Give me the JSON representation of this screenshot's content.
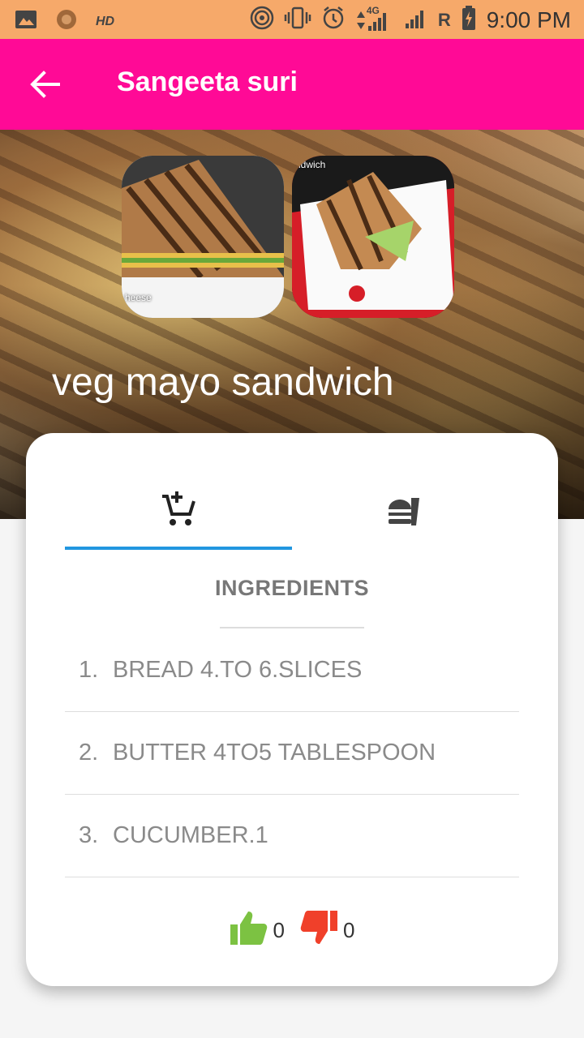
{
  "status_bar": {
    "hd_label": "HD",
    "network": "4G",
    "roaming": "R",
    "time": "9:00 PM",
    "icons": [
      "gallery-icon",
      "app-icon",
      "hotspot-icon",
      "vibrate-icon",
      "alarm-icon",
      "signal-icon",
      "battery-icon"
    ]
  },
  "app_bar": {
    "back_icon": "arrow-back-icon",
    "title": "Sangeeta suri",
    "color": "#ff0a96"
  },
  "hero": {
    "thumbnails": [
      {
        "caption": "heese"
      },
      {
        "caption": "ndwich"
      }
    ],
    "recipe_name": "veg mayo sandwich"
  },
  "tabs": [
    {
      "icon": "cart-add-icon",
      "active": true
    },
    {
      "icon": "food-icon",
      "active": false
    }
  ],
  "ingredients": {
    "title": "INGREDIENTS",
    "items": [
      {
        "num": "1.",
        "text": "BREAD 4.TO 6.SLICES"
      },
      {
        "num": "2.",
        "text": "BUTTER 4TO5 TABLESPOON"
      },
      {
        "num": "3.",
        "text": "CUCUMBER.1"
      }
    ]
  },
  "votes": {
    "likes": "0",
    "dislikes": "0",
    "like_color": "#7cc242",
    "dislike_color": "#f0402a"
  },
  "colors": {
    "status_bar": "#f6a96a",
    "tab_indicator": "#2196e0"
  }
}
